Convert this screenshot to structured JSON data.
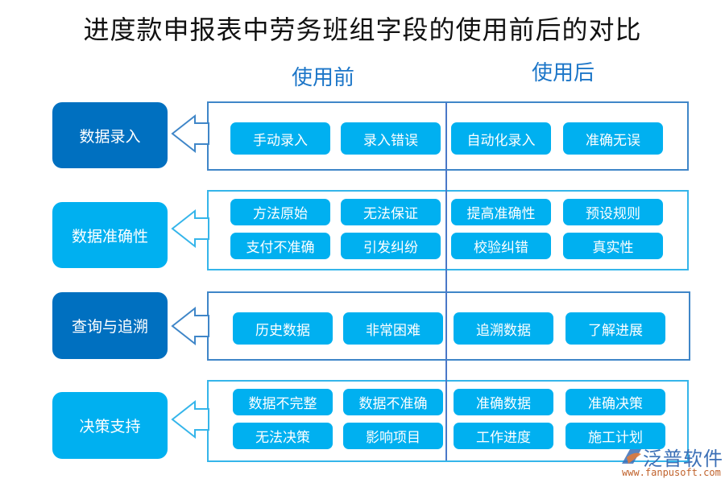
{
  "title": "进度款申报表中劳务班组字段的使用前后的对比",
  "columns": {
    "before": "使用前",
    "after": "使用后"
  },
  "colors": {
    "dark_blue": "#0070c0",
    "light_blue": "#00b0f0",
    "header_blue": "#1c76c8",
    "border_blue": "#3f86c8"
  },
  "rows": [
    {
      "category": "数据录入",
      "before": [
        "手动录入",
        "录入错误"
      ],
      "after": [
        "自动化录入",
        "准确无误"
      ]
    },
    {
      "category": "数据准确性",
      "before": [
        "方法原始",
        "无法保证",
        "支付不准确",
        "引发纠纷"
      ],
      "after": [
        "提高准确性",
        "预设规则",
        "校验纠错",
        "真实性"
      ]
    },
    {
      "category": "查询与追溯",
      "before": [
        "历史数据",
        "非常困难"
      ],
      "after": [
        "追溯数据",
        "了解进展"
      ]
    },
    {
      "category": "决策支持",
      "before": [
        "数据不完整",
        "数据不准确",
        "无法决策",
        "影响项目"
      ],
      "after": [
        "准确数据",
        "准确决策",
        "工作进度",
        "施工计划"
      ]
    }
  ],
  "logo": {
    "name": "泛普软件",
    "url": "www.fanpusoft.com",
    "icon": "fanpu-logo-icon"
  }
}
